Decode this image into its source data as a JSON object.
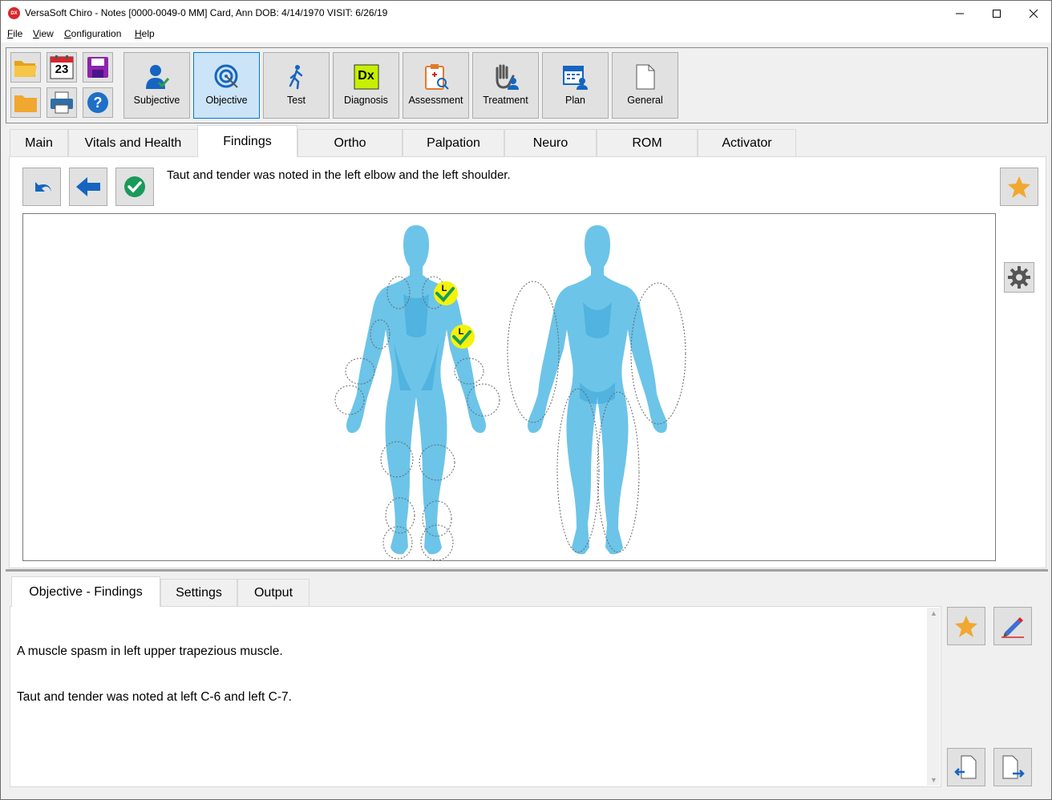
{
  "window": {
    "app_icon_text": "DX",
    "title": "VersaSoft Chiro - Notes [0000-0049-0 MM]   Card, Ann   DOB: 4/14/1970   VISIT: 6/26/19"
  },
  "menu": {
    "items": [
      {
        "accel": "F",
        "rest": "ile"
      },
      {
        "accel": "V",
        "rest": "iew"
      },
      {
        "accel": "C",
        "rest": "onfiguration"
      },
      {
        "accel": "H",
        "rest": "elp"
      }
    ]
  },
  "toolbar": {
    "calendar_day": "23",
    "dx_label": "Dx",
    "modules": [
      {
        "label": "Subjective"
      },
      {
        "label": "Objective"
      },
      {
        "label": "Test"
      },
      {
        "label": "Diagnosis"
      },
      {
        "label": "Assessment"
      },
      {
        "label": "Treatment"
      },
      {
        "label": "Plan"
      },
      {
        "label": "General"
      }
    ],
    "active_module": "Objective"
  },
  "main_tabs": [
    {
      "label": "Main"
    },
    {
      "label": "Vitals and Health"
    },
    {
      "label": "Findings"
    },
    {
      "label": "Ortho"
    },
    {
      "label": "Palpation"
    },
    {
      "label": "Neuro"
    },
    {
      "label": "ROM"
    },
    {
      "label": "Activator"
    }
  ],
  "selected_main_tab": "Findings",
  "findings": {
    "sentence": "Taut and tender was noted in the left elbow and the left shoulder.",
    "markers": [
      {
        "side_label": "L",
        "region": "left shoulder"
      },
      {
        "side_label": "L",
        "region": "left elbow"
      }
    ]
  },
  "bottom_tabs": [
    {
      "label": "Objective - Findings"
    },
    {
      "label": "Settings"
    },
    {
      "label": "Output"
    }
  ],
  "selected_bottom_tab": "Objective - Findings",
  "notes": {
    "line1": "A muscle spasm in left upper trapezious muscle.",
    "line2": "Taut and tender was noted at left C-6 and left C-7."
  },
  "colors": {
    "body_fill": "#6cc4e8",
    "body_shade": "#3aa6d8",
    "marker_fill": "#f5f20a",
    "check_green": "#1a9a5a",
    "star": "#f0a830",
    "active_tab_bg": "#cce4f7",
    "accent_blue": "#1565c0"
  }
}
